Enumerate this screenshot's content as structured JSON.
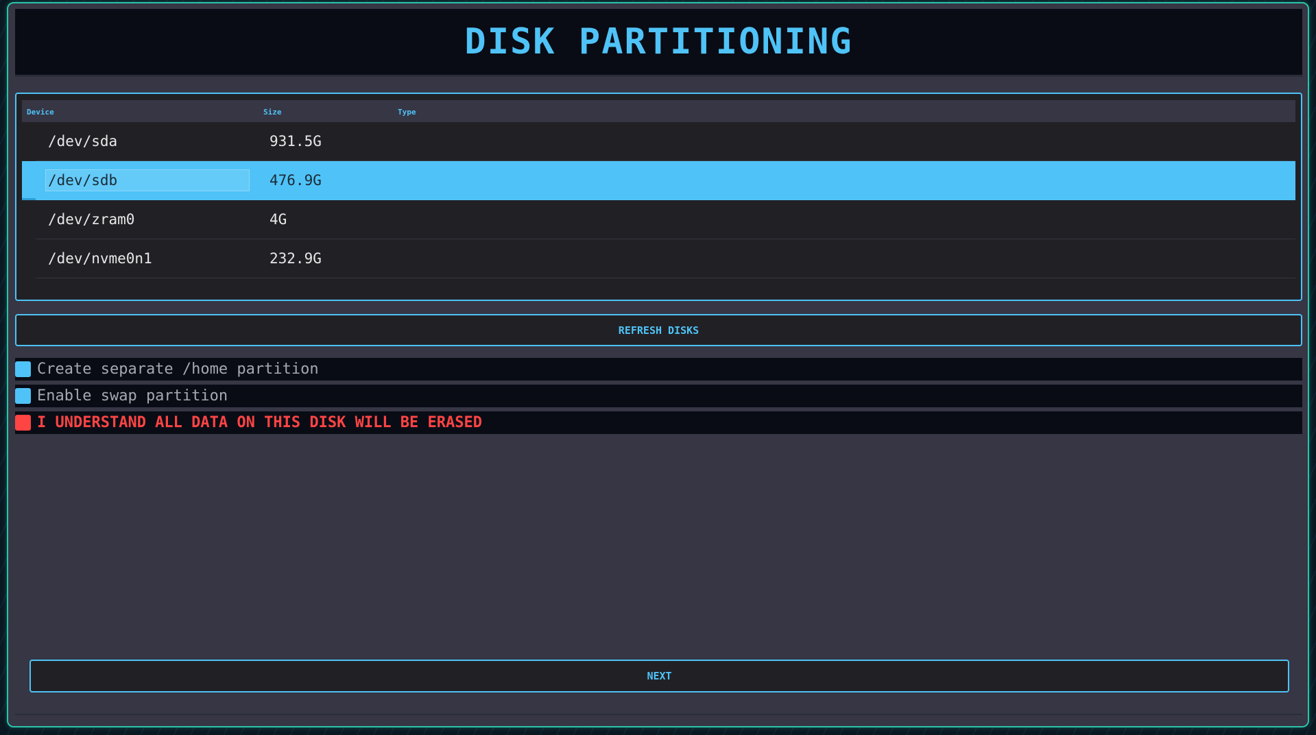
{
  "header": {
    "title": "DISK PARTITIONING"
  },
  "disk_table": {
    "columns": [
      "Device",
      "Size",
      "Type"
    ],
    "rows": [
      {
        "device": "/dev/sda",
        "size": "931.5G",
        "type": "",
        "selected": false
      },
      {
        "device": "/dev/sdb",
        "size": "476.9G",
        "type": "",
        "selected": true
      },
      {
        "device": "/dev/zram0",
        "size": "4G",
        "type": "",
        "selected": false
      },
      {
        "device": "/dev/nvme0n1",
        "size": "232.9G",
        "type": "",
        "selected": false
      }
    ]
  },
  "actions": {
    "refresh_label": "REFRESH DISKS",
    "next_label": "NEXT"
  },
  "options": [
    {
      "label": "Create separate /home partition",
      "checked": true
    },
    {
      "label": "Enable swap partition",
      "checked": true
    },
    {
      "label": "I UNDERSTAND ALL DATA ON THIS DISK WILL BE ERASED",
      "checked": true,
      "danger": true
    }
  ],
  "colors": {
    "accent": "#4fc3f7",
    "danger": "#ff4444",
    "window_border": "#2bc4a8",
    "panel_bg": "#212125",
    "window_bg": "#363645",
    "header_bg": "#090c15"
  }
}
